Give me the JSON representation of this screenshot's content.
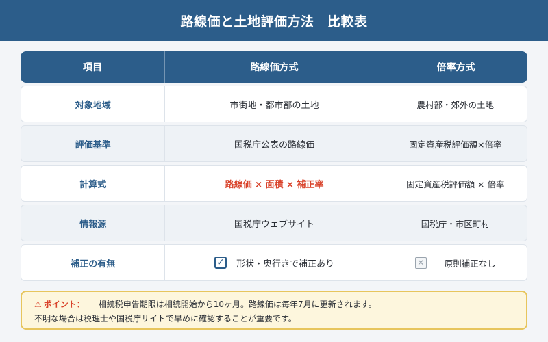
{
  "title": "路線価と土地評価方法　比較表",
  "table": {
    "headers": [
      "項目",
      "路線価方式",
      "倍率方式"
    ],
    "rows": [
      {
        "item": "対象地域",
        "route": "市街地・都市部の土地",
        "multiplier": "農村部・郊外の土地"
      },
      {
        "item": "評価基準",
        "route": "国税庁公表の路線価",
        "multiplier": "固定資産税評価額×倍率"
      },
      {
        "item": "計算式",
        "route": "路線価 × 面積 × 補正率",
        "multiplier": "固定資産税評価額 × 倍率"
      },
      {
        "item": "情報源",
        "route": "国税庁ウェブサイト",
        "multiplier": "国税庁・市区町村"
      },
      {
        "item": "補正の有無",
        "route": "形状・奥行きで補正あり",
        "multiplier": "原則補正なし"
      }
    ],
    "route_correction_checked": true,
    "multiplier_correction_checked": false
  },
  "note": {
    "label": "ポイント：",
    "line1": "相続税申告期限は相続開始から10ヶ月。路線価は毎年7月に更新されます。",
    "line2": "不明な場合は税理士や国税庁サイトで早めに確認することが重要です。",
    "icon": "warning-icon"
  },
  "colors": {
    "primary": "#2c5d8a",
    "accent_red": "#d9432b",
    "note_bg": "#fdf6dd",
    "note_border": "#e7c55d"
  }
}
